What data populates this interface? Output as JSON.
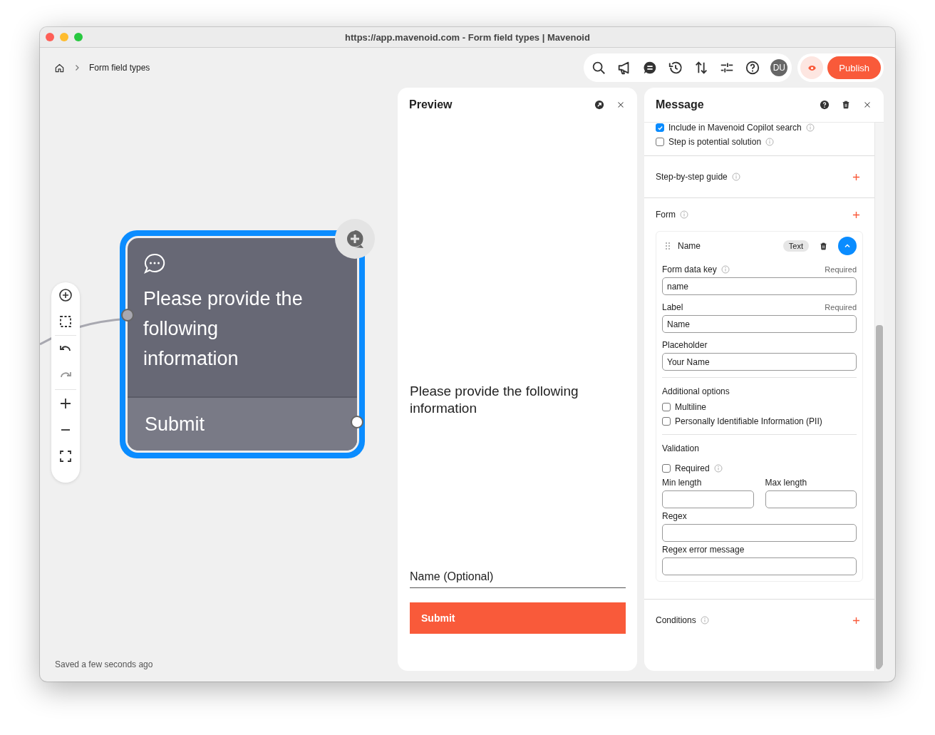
{
  "window": {
    "title": "https://app.mavenoid.com - Form field types | Mavenoid"
  },
  "breadcrumb": {
    "current": "Form field types"
  },
  "toolbar": {
    "avatar": "DU",
    "publish": "Publish"
  },
  "canvas": {
    "node": {
      "message": "Please provide the following information",
      "button": "Submit",
      "selected": true
    },
    "status": "Saved a few seconds ago"
  },
  "preview": {
    "title": "Preview",
    "message": "Please provide the following information",
    "field_label": "Name (Optional)",
    "submit": "Submit"
  },
  "message_panel": {
    "title": "Message",
    "options": [
      {
        "label": "Include in Mavenoid Copilot search",
        "checked": true
      },
      {
        "label": "Step is potential solution",
        "checked": false
      }
    ],
    "step_guide": {
      "title": "Step-by-step guide"
    },
    "form": {
      "title": "Form",
      "field": {
        "name": "Name",
        "type": "Text",
        "expanded": true,
        "form_data_key": {
          "label": "Form data key",
          "note": "Required",
          "value": "name"
        },
        "label": {
          "label": "Label",
          "note": "Required",
          "value": "Name"
        },
        "placeholder": {
          "label": "Placeholder",
          "value": "Your Name"
        },
        "additional_options": {
          "title": "Additional options",
          "options": [
            {
              "label": "Multiline",
              "checked": false
            },
            {
              "label": "Personally Identifiable Information (PII)",
              "checked": false
            }
          ]
        },
        "validation": {
          "title": "Validation",
          "required": {
            "label": "Required",
            "checked": false
          },
          "min_length": {
            "label": "Min length"
          },
          "max_length": {
            "label": "Max length"
          },
          "regex": {
            "label": "Regex"
          },
          "regex_error": {
            "label": "Regex error message"
          }
        }
      }
    },
    "conditions": {
      "title": "Conditions"
    }
  }
}
